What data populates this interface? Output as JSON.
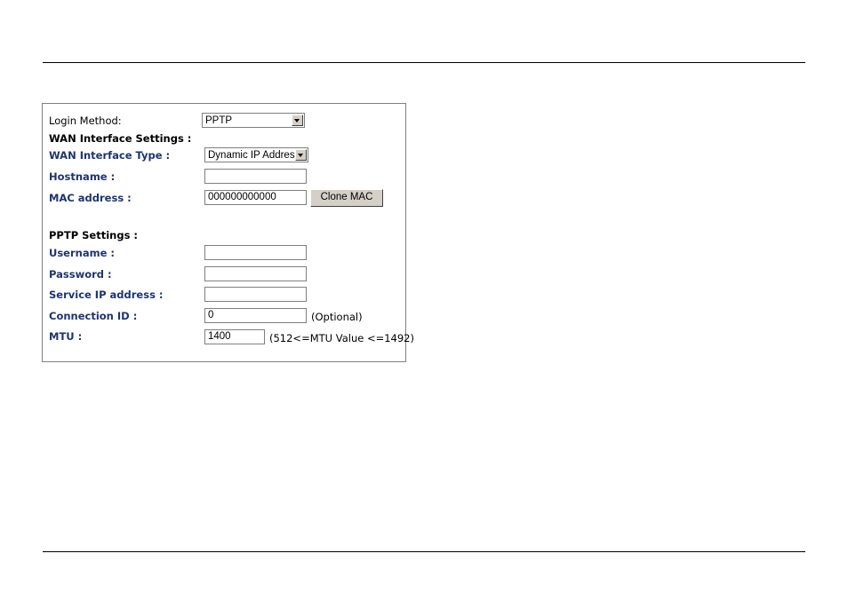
{
  "form": {
    "login_method": {
      "label": "Login Method:",
      "value": "PPTP"
    },
    "wan_section_title": "WAN Interface Settings :",
    "wan_interface_type": {
      "label": "WAN Interface Type :",
      "value": "Dynamic IP Address"
    },
    "hostname": {
      "label": "Hostname :",
      "value": ""
    },
    "mac_address": {
      "label": "MAC address :",
      "value": "000000000000",
      "clone_button": "Clone MAC"
    },
    "pptp_section_title": "PPTP Settings :",
    "username": {
      "label": "Username :",
      "value": ""
    },
    "password": {
      "label": "Password :",
      "value": ""
    },
    "service_ip": {
      "label": "Service IP address :",
      "value": ""
    },
    "connection_id": {
      "label": "Connection ID :",
      "value": "0",
      "note": "(Optional)"
    },
    "mtu": {
      "label": "MTU :",
      "value": "1400",
      "note": "(512<=MTU Value <=1492)"
    }
  },
  "colors": {
    "label_blue": "#1e3470",
    "border": "#808080",
    "button_face": "#d4d0c8"
  }
}
